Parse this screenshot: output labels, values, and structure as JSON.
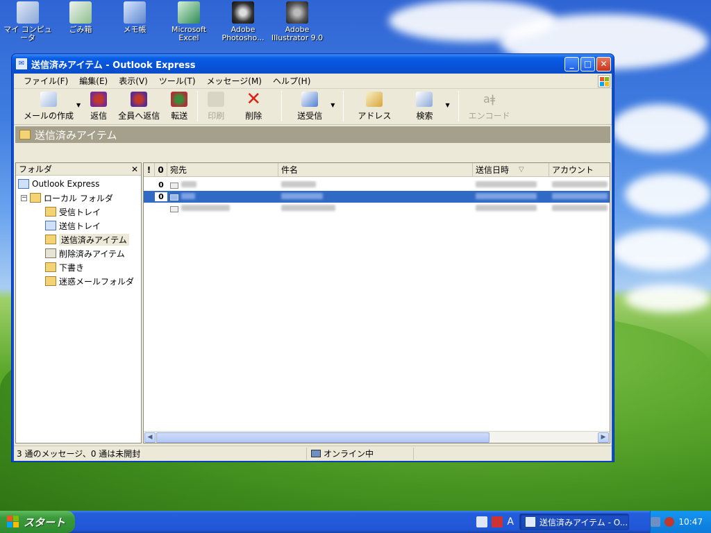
{
  "desktop": {
    "icons": [
      {
        "label": "マイ コンピュータ",
        "icon": "my-computer-icon"
      },
      {
        "label": "ごみ箱",
        "icon": "recycle-bin-icon"
      },
      {
        "label": "メモ帳",
        "icon": "notepad-icon"
      },
      {
        "label": "Microsoft Excel",
        "icon": "excel-icon"
      },
      {
        "label": "Adobe Photosho...",
        "icon": "photoshop-icon"
      },
      {
        "label": "Adobe Illustrator 9.0",
        "icon": "illustrator-icon"
      }
    ]
  },
  "window": {
    "title": "送信済みアイテム - Outlook Express",
    "minimize": "_",
    "maximize": "□",
    "close": "✕"
  },
  "menu": [
    "ファイル(F)",
    "編集(E)",
    "表示(V)",
    "ツール(T)",
    "メッセージ(M)",
    "ヘルプ(H)"
  ],
  "toolbar": {
    "compose": "メールの作成",
    "reply": "返信",
    "reply_all": "全員へ返信",
    "forward": "転送",
    "print": "印刷",
    "delete": "削除",
    "send_receive": "送受信",
    "address": "アドレス",
    "find": "検索",
    "encode": "エンコード"
  },
  "folder_bar": {
    "title": "送信済みアイテム"
  },
  "folders": {
    "header": "フォルダ",
    "close": "✕",
    "root": "Outlook Express",
    "local": "ローカル フォルダ",
    "items": [
      "受信トレイ",
      "送信トレイ",
      "送信済みアイテム",
      "削除済みアイテム",
      "下書き",
      "迷惑メールフォルダ"
    ],
    "selected": "送信済みアイテム"
  },
  "list": {
    "columns": {
      "priority": "!",
      "attachment": "0",
      "to": "宛先",
      "subject": "件名",
      "sent": "送信日時",
      "sort_arrow": "▽",
      "account": "アカウント"
    },
    "rows": [
      {
        "attach": "0",
        "selected": false
      },
      {
        "attach": "0",
        "selected": true
      },
      {
        "attach": "",
        "selected": false
      }
    ]
  },
  "status": {
    "messages": "3 通のメッセージ、0 通は未開封",
    "online": "オンライン中"
  },
  "taskbar": {
    "start": "スタート",
    "ime": "A",
    "task_title": "送信済みアイテム - O...",
    "clock": "10:47"
  },
  "colors": {
    "titlebar": "#0a5ee6",
    "selection": "#316ac5",
    "start_green": "#3c9b3c",
    "tray_blue": "#0d79d9"
  }
}
